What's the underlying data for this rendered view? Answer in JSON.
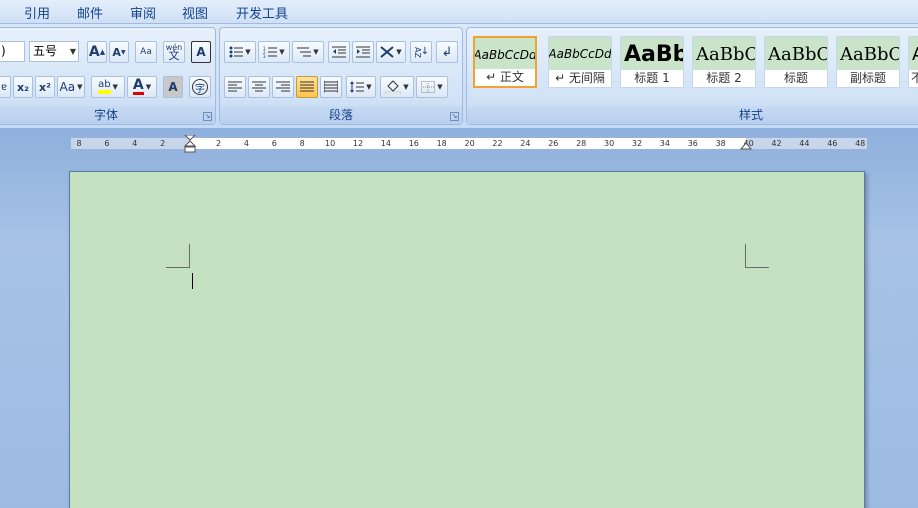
{
  "menu": {
    "items": [
      "引用",
      "邮件",
      "审阅",
      "视图",
      "开发工具"
    ]
  },
  "font_group": {
    "label": "字体",
    "font_name_partial": ")",
    "font_size": "五号",
    "grow_font": "A",
    "shrink_font": "A",
    "clear_format": "Aa",
    "phonetic": "wén",
    "char_border": "A",
    "subscript": "x₂",
    "superscript": "x²",
    "change_case": "Aa",
    "highlight": "ab",
    "font_color": "A",
    "char_shading": "A",
    "enclose_char": "字"
  },
  "paragraph_group": {
    "label": "段落",
    "sort_icon_text": "AZ"
  },
  "styles_group": {
    "label": "样式",
    "tiles": [
      {
        "preview": "AaBbCcDd",
        "name": "↵ 正文",
        "selected": true
      },
      {
        "preview": "AaBbCcDd",
        "name": "↵ 无间隔",
        "selected": false
      },
      {
        "preview": "AaBb",
        "name": "标题 1",
        "selected": false
      },
      {
        "preview": "AaBbC",
        "name": "标题 2",
        "selected": false
      },
      {
        "preview": "AaBbC",
        "name": "标题",
        "selected": false
      },
      {
        "preview": "AaBbC",
        "name": "副标题",
        "selected": false
      },
      {
        "preview": "A",
        "name": "不",
        "selected": false
      }
    ]
  },
  "ruler": {
    "ticks": [
      "8",
      "6",
      "4",
      "2",
      "2",
      "4",
      "6",
      "8",
      "10",
      "12",
      "14",
      "16",
      "18",
      "20",
      "22",
      "24",
      "26",
      "28",
      "30",
      "32",
      "34",
      "36",
      "38",
      "40",
      "42",
      "44",
      "46",
      "48"
    ]
  },
  "colors": {
    "page_background": "#c3e1c0",
    "ribbon": "#d2e3f6",
    "accent": "#15428b"
  }
}
